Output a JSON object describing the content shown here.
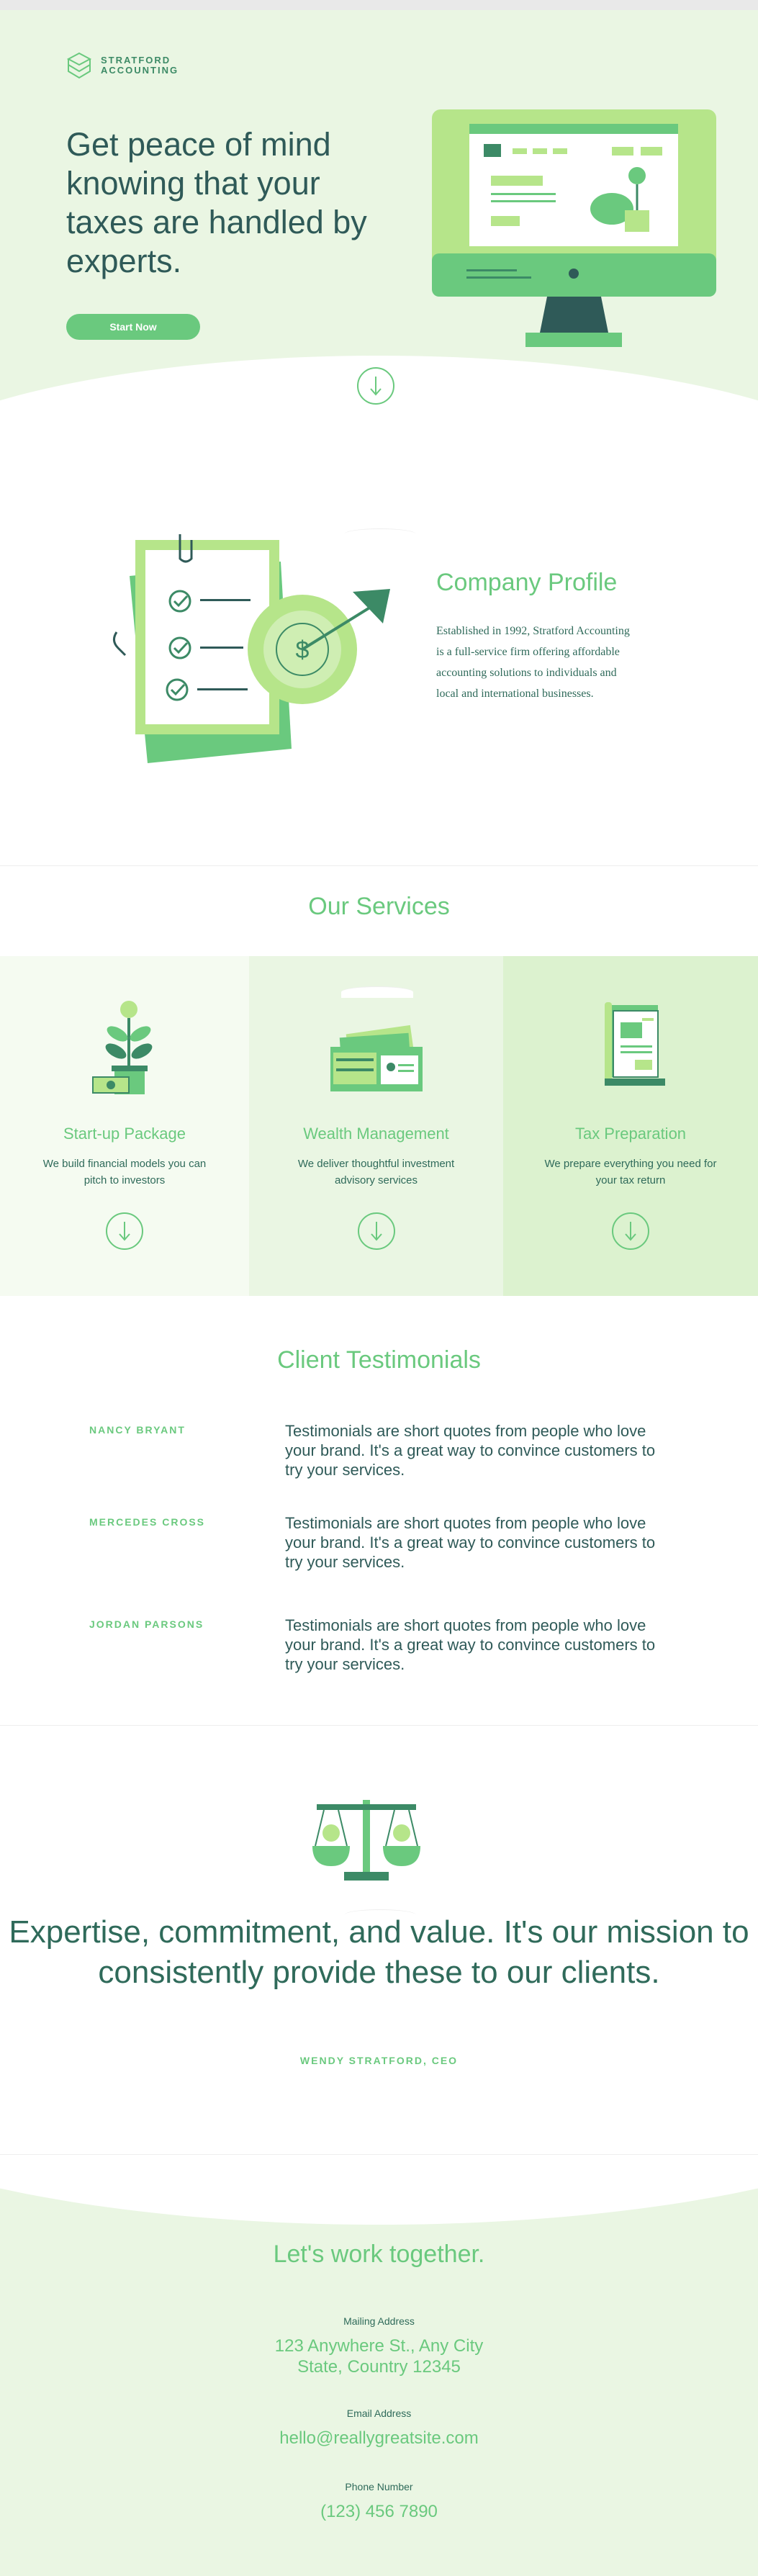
{
  "brand": {
    "line1": "STRATFORD",
    "line2": "ACCOUNTING"
  },
  "hero": {
    "title": "Get peace of mind knowing that your taxes are handled by experts.",
    "cta_label": "Start Now"
  },
  "profile": {
    "title": "Company Profile",
    "text": "Established in 1992, Stratford Accounting is a full-service firm offering affordable accounting solutions to individuals and local and international businesses."
  },
  "services": {
    "title": "Our Services",
    "items": [
      {
        "name": "Start-up Package",
        "desc": "We build financial models you can pitch to investors",
        "icon": "plant-money-icon"
      },
      {
        "name": "Wealth Management",
        "desc": "We deliver thoughtful investment advisory services",
        "icon": "wallet-icon"
      },
      {
        "name": "Tax Preparation",
        "desc": "We prepare everything you need for your tax return",
        "icon": "tax-document-icon"
      }
    ]
  },
  "testimonials": {
    "title": "Client Testimonials",
    "items": [
      {
        "name": "NANCY BRYANT",
        "quote": "Testimonials are short quotes from people who love your brand. It's a great way to convince customers to try your services."
      },
      {
        "name": "MERCEDES CROSS",
        "quote": "Testimonials are short quotes from people who love your brand. It's a great way to convince customers to try your services."
      },
      {
        "name": "JORDAN PARSONS",
        "quote": "Testimonials are short quotes from people who love your brand. It's a great way to convince customers to try your services."
      }
    ]
  },
  "mission": {
    "text": "Expertise, commitment, and value. It's our mission to consistently provide these to our clients.",
    "author": "WENDY STRATFORD, CEO"
  },
  "contact": {
    "title": "Let's work together.",
    "mailing_label": "Mailing Address",
    "mailing_line1": "123 Anywhere St., Any City",
    "mailing_line2": "State, Country 12345",
    "email_label": "Email Address",
    "email_value": "hello@reallygreatsite.com",
    "phone_label": "Phone Number",
    "phone_value": "(123) 456 7890"
  },
  "colors": {
    "accent": "#6ac97e",
    "text": "#2f5a58",
    "mint": "#eaf6e3",
    "bright": "#b6e58a"
  }
}
